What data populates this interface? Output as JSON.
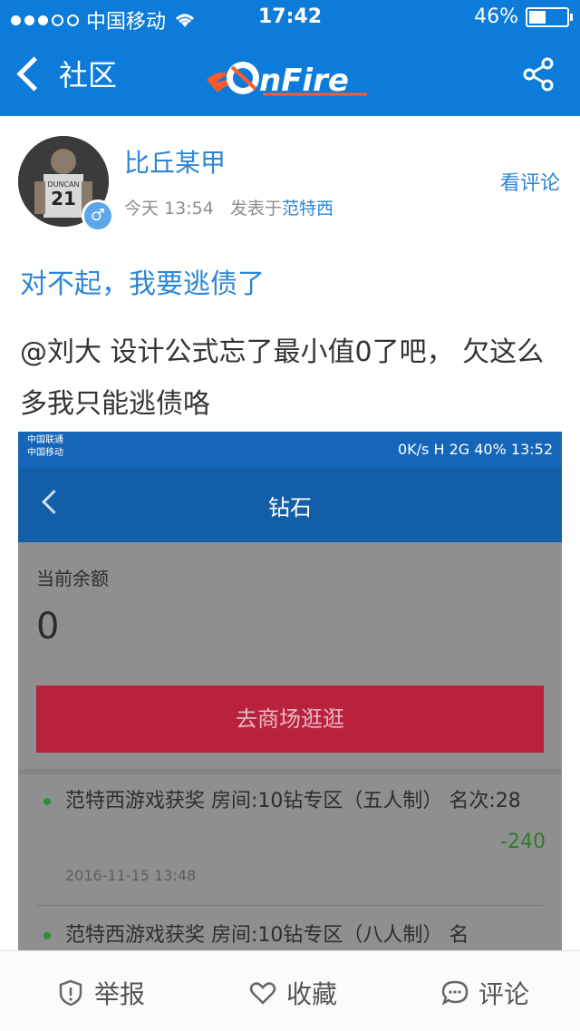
{
  "status_bar": {
    "carrier": "中国移动",
    "time": "17:42",
    "battery": "46%"
  },
  "nav": {
    "back_label": "社区",
    "logo_text": "nFire",
    "share_icon": "share-icon"
  },
  "post": {
    "author": "比丘某甲",
    "time": "今天 13:54",
    "posted_in_prefix": "发表于",
    "board": "范特西",
    "view_comments": "看评论",
    "title": "对不起，我要逃债了",
    "body": "@刘大  设计公式忘了最小值0了吧， 欠这么多我只能逃债咯",
    "avatar_jersey": "21",
    "avatar_name": "DUNCAN"
  },
  "embedded": {
    "status": {
      "carrier_1": "中国联通",
      "carrier_2": "中国移动",
      "right": "0K/s  H  2G  40%  13:52"
    },
    "title": "钻石",
    "balance_label": "当前余额",
    "balance_value": "0",
    "shop_button": "去商场逛逛",
    "records": [
      {
        "text": "范特西游戏获奖 房间:10钻专区（五人制） 名次:28",
        "amount": "-240",
        "date": "2016-11-15 13:48"
      },
      {
        "text": "范特西游戏获奖 房间:10钻专区（八人制） 名"
      }
    ]
  },
  "bottom_bar": {
    "report": "举报",
    "favorite": "收藏",
    "comment": "评论"
  },
  "colors": {
    "brand_blue": "#0d7bd9",
    "link_blue": "#2b86d6"
  }
}
